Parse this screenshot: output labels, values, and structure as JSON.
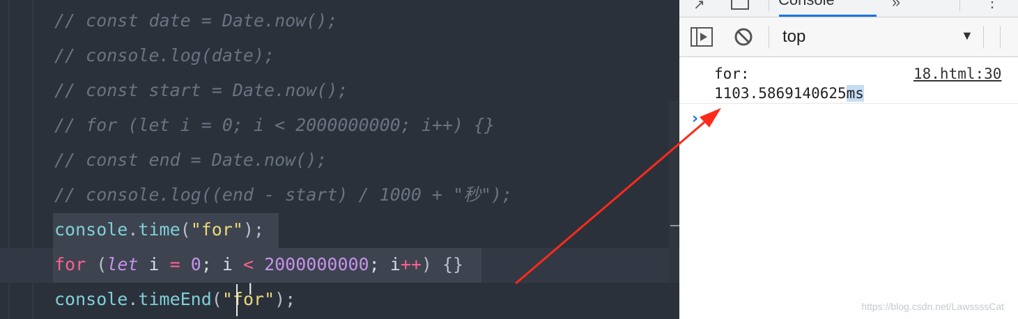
{
  "editor": {
    "comment_lines": [
      "// const date = Date.now();",
      "// console.log(date);",
      "// const start = Date.now();",
      "// for (let i = 0; i < 2000000000; i++) {}",
      "// const end = Date.now();",
      "// console.log((end - start) / 1000 + \"秒\");"
    ],
    "line7": {
      "obj": "console",
      "dot": ".",
      "method": "time",
      "open": "(",
      "str": "\"for\"",
      "close": ");"
    },
    "line8": {
      "kw_for": "for",
      "open": " (",
      "kw_let": "let",
      "var": " i ",
      "eq": "=",
      "zero": " 0",
      "semi1": "; i ",
      "lt": "<",
      "num": " 2000000000",
      "semi2": "; i",
      "inc": "++",
      "end": ") {}"
    },
    "line9": {
      "obj": "console",
      "dot": ".",
      "method": "timeEnd",
      "open": "(",
      "q1": "\"",
      "str": "for",
      "q2": "\"",
      "close": ");"
    }
  },
  "devtools": {
    "tab_console": "Console",
    "overflow_tabs": "»",
    "context": "top",
    "messages": [
      {
        "label": "for:",
        "value_main": "1103.5869140625",
        "value_unit": "ms",
        "source": "18.html:30"
      }
    ],
    "prompt": "›"
  },
  "watermark": "https://blog.csdn.net/LawssssCat",
  "colors": {
    "editor_bg": "#2b313b",
    "arrow": "#ff2a1a",
    "accent": "#1a73e8"
  }
}
